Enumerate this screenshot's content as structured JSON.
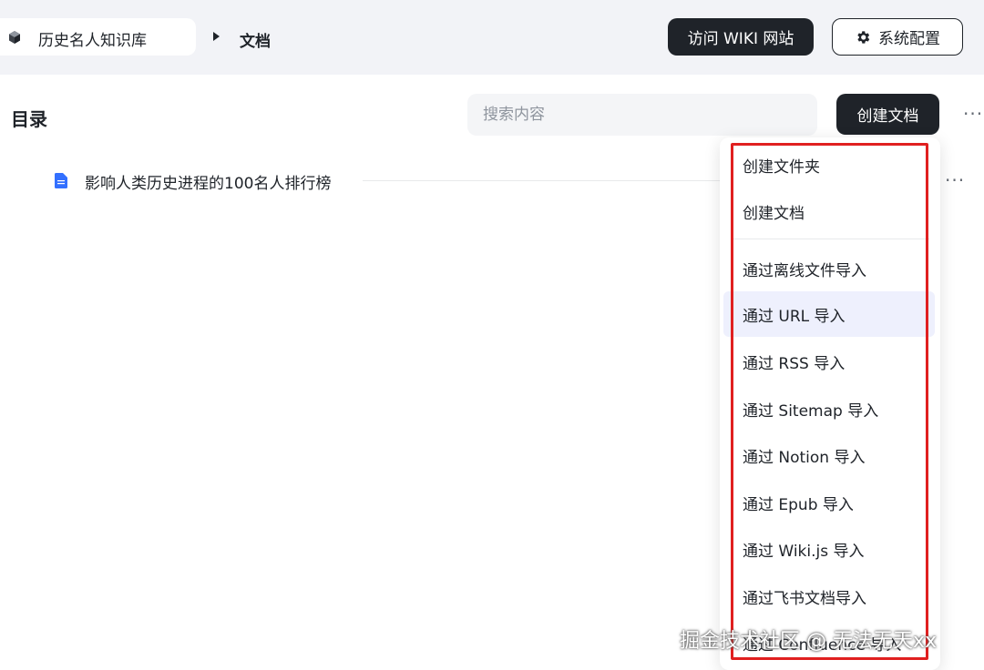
{
  "header": {
    "kb_name": "历史名人知识库",
    "breadcrumb_current": "文档",
    "visit_button": "访问 WIKI 网站",
    "config_button": "系统配置"
  },
  "toolbar": {
    "toc_title": "目录",
    "search_placeholder": "搜索内容",
    "create_button": "创建文档",
    "more_icon": "more-horizontal-icon"
  },
  "documents": [
    {
      "title": "影响人类历史进程的100名人排行榜",
      "icon": "document-icon"
    }
  ],
  "create_menu": {
    "items": [
      "创建文件夹",
      "创建文档",
      "通过离线文件导入",
      "通过 URL 导入",
      "通过 RSS 导入",
      "通过 Sitemap 导入",
      "通过 Notion 导入",
      "通过 Epub 导入",
      "通过 Wiki.js 导入",
      "通过飞书文档导入",
      "通过 Confluence 导入"
    ],
    "active_item": "通过 URL 导入"
  },
  "annotation": {
    "color": "#e02020"
  },
  "watermark": "掘金技术社区 @ 无法无天xx",
  "colors": {
    "dark_button": "#1f2329",
    "active_bg": "#eef0fd",
    "topbar_bg": "#f2f3f7"
  }
}
